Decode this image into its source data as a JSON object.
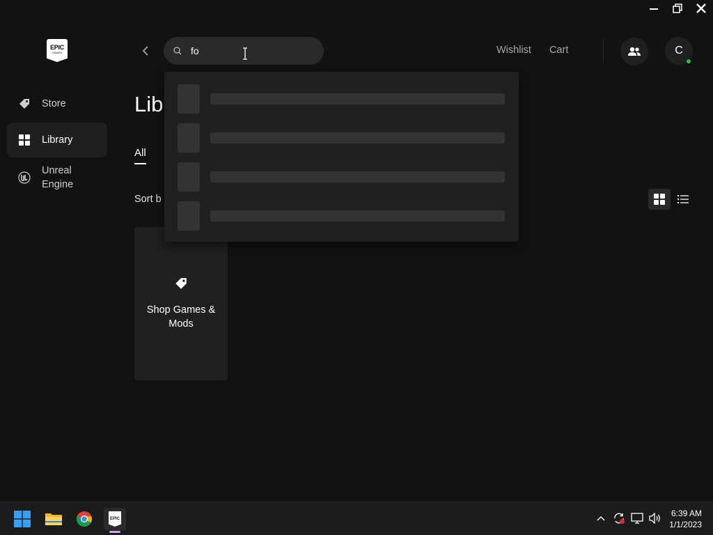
{
  "logo": {
    "line1": "EPIC",
    "line2": "GAMES"
  },
  "sidebar": {
    "items": [
      {
        "label": "Store",
        "icon": "tag-icon",
        "active": false
      },
      {
        "label": "Library",
        "icon": "grid-icon",
        "active": true
      },
      {
        "label": "Unreal Engine",
        "icon": "unreal-icon",
        "active": false
      }
    ]
  },
  "search": {
    "value": "fo",
    "placeholder": ""
  },
  "topnav": {
    "wishlist": "Wishlist",
    "cart": "Cart",
    "avatar_initial": "C"
  },
  "main": {
    "title": "Lib",
    "tab_all": "All",
    "sort_label": "Sort b",
    "shop_card": {
      "label": "Shop Games & Mods",
      "icon": "tag-icon"
    }
  },
  "search_dropdown": {
    "loading_rows": 4
  },
  "taskbar": {
    "apps": [
      "start-icon",
      "file-explorer-icon",
      "chrome-icon",
      "epic-games-icon"
    ],
    "clock": {
      "time": "6:39 AM",
      "date": "1/1/2023"
    }
  },
  "colors": {
    "background": "#121212",
    "panel": "#202020",
    "online": "#27c24c"
  }
}
